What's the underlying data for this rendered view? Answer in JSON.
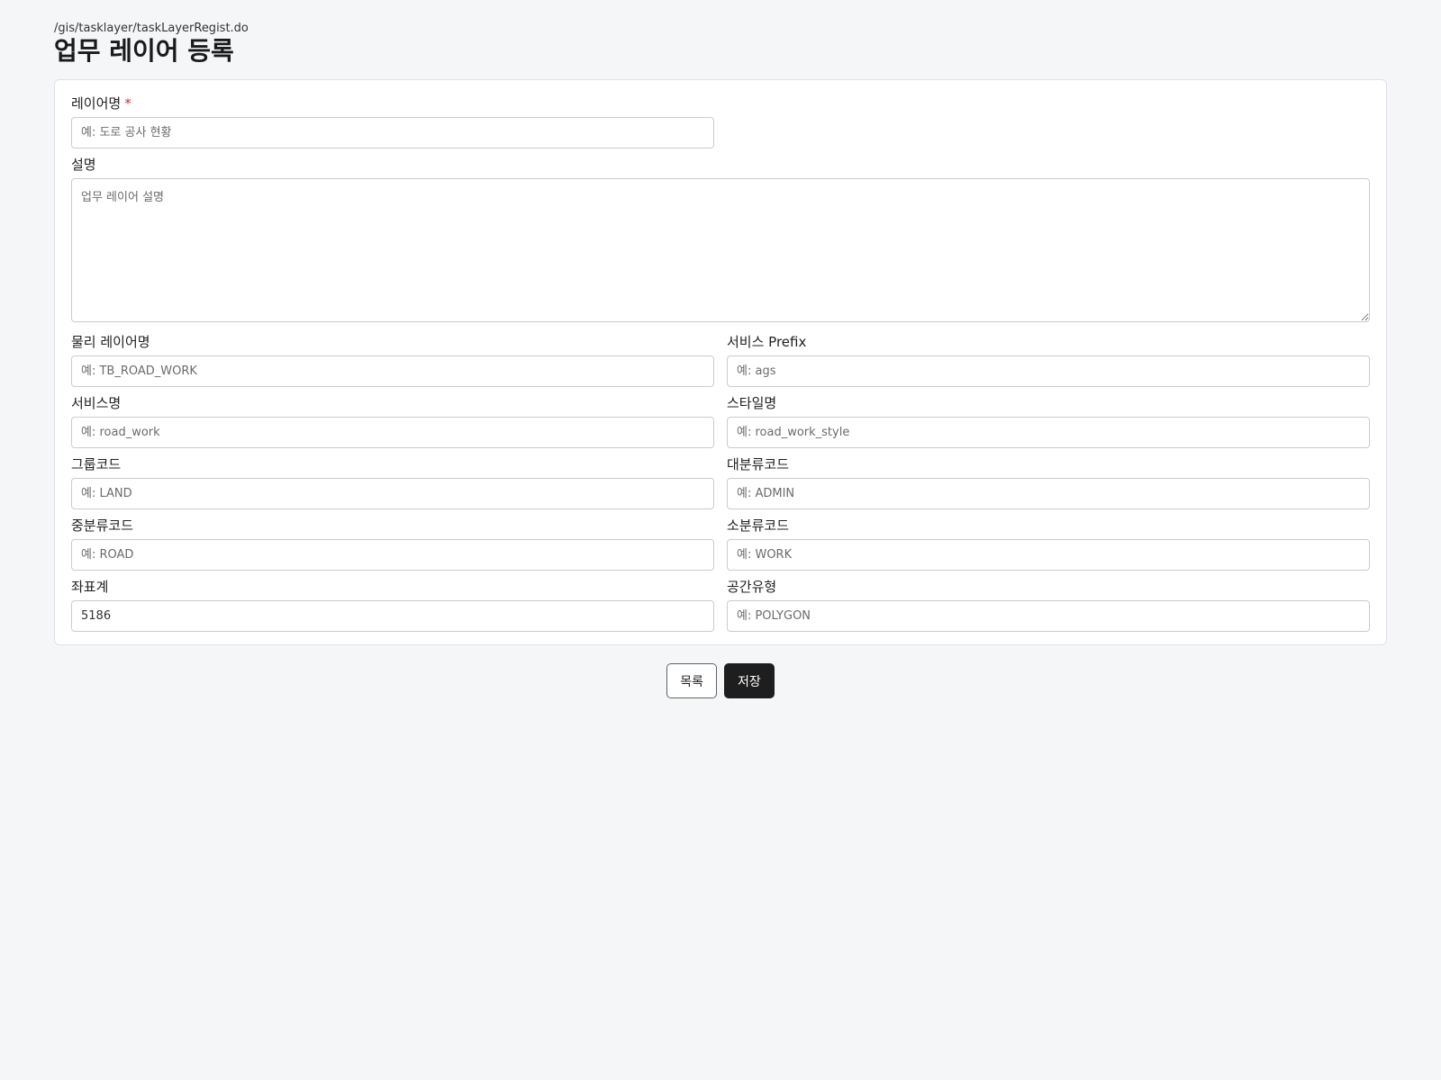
{
  "header": {
    "route": "/gis/tasklayer/taskLayerRegist.do",
    "title": "업무 레이어 등록"
  },
  "form": {
    "layer_name": {
      "label": "레이어명",
      "required_mark": "*",
      "placeholder": "예: 도로 공사 현황",
      "value": ""
    },
    "description": {
      "label": "설명",
      "placeholder": "업무 레이어 설명",
      "value": ""
    },
    "physical_layer_name": {
      "label": "물리 레이어명",
      "placeholder": "예: TB_ROAD_WORK",
      "value": ""
    },
    "service_prefix": {
      "label": "서비스 Prefix",
      "placeholder": "예: ags",
      "value": ""
    },
    "service_name": {
      "label": "서비스명",
      "placeholder": "예: road_work",
      "value": ""
    },
    "style_name": {
      "label": "스타일명",
      "placeholder": "예: road_work_style",
      "value": ""
    },
    "group_code": {
      "label": "그룹코드",
      "placeholder": "예: LAND",
      "value": ""
    },
    "major_class_code": {
      "label": "대분류코드",
      "placeholder": "예: ADMIN",
      "value": ""
    },
    "middle_class_code": {
      "label": "중분류코드",
      "placeholder": "예: ROAD",
      "value": ""
    },
    "minor_class_code": {
      "label": "소분류코드",
      "placeholder": "예: WORK",
      "value": ""
    },
    "coordinate_system": {
      "label": "좌표계",
      "placeholder": "",
      "value": "5186"
    },
    "spatial_type": {
      "label": "공간유형",
      "placeholder": "예: POLYGON",
      "value": ""
    }
  },
  "actions": {
    "list_label": "목록",
    "save_label": "저장"
  }
}
